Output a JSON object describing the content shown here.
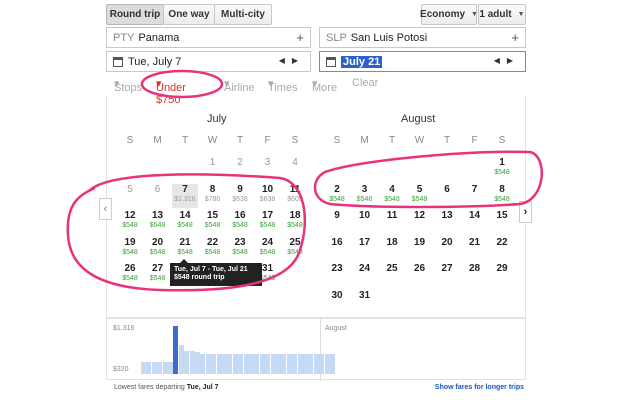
{
  "trip_tabs": [
    {
      "label": "Round trip",
      "selected": true
    },
    {
      "label": "One way"
    },
    {
      "label": "Multi-city"
    }
  ],
  "cabin": "Economy",
  "passengers": "1 adult",
  "origin": {
    "code": "PTY",
    "city": "Panama"
  },
  "destination": {
    "code": "SLP",
    "city": "San Luis Potosi"
  },
  "depart_date": "Tue, July 7",
  "return_date": "July 21",
  "filters": {
    "stops": "Stops",
    "price": "Under $750",
    "airline": "Airline",
    "times": "Times",
    "more": "More",
    "clear": "Clear"
  },
  "weekdays": [
    "S",
    "M",
    "T",
    "W",
    "T",
    "F",
    "S"
  ],
  "july": {
    "name": "July",
    "days": [
      {
        "d": "1",
        "p": ""
      },
      {
        "d": "2",
        "p": ""
      },
      {
        "d": "3",
        "p": ""
      },
      {
        "d": "4",
        "p": ""
      },
      {
        "d": "5",
        "p": ""
      },
      {
        "d": "6",
        "p": ""
      },
      {
        "d": "7",
        "p": "$1,316"
      },
      {
        "d": "8",
        "p": "$780"
      },
      {
        "d": "9",
        "p": "$638"
      },
      {
        "d": "10",
        "p": "$638"
      },
      {
        "d": "11",
        "p": "$609"
      },
      {
        "d": "12",
        "p": "$548"
      },
      {
        "d": "13",
        "p": "$548"
      },
      {
        "d": "14",
        "p": "$548"
      },
      {
        "d": "15",
        "p": "$548"
      },
      {
        "d": "16",
        "p": "$548"
      },
      {
        "d": "17",
        "p": "$548"
      },
      {
        "d": "18",
        "p": "$548"
      },
      {
        "d": "19",
        "p": "$548"
      },
      {
        "d": "20",
        "p": "$548"
      },
      {
        "d": "21",
        "p": "$548"
      },
      {
        "d": "22",
        "p": "$548"
      },
      {
        "d": "23",
        "p": "$548"
      },
      {
        "d": "24",
        "p": "$548"
      },
      {
        "d": "25",
        "p": "$548"
      },
      {
        "d": "26",
        "p": "$548"
      },
      {
        "d": "27",
        "p": "$548"
      },
      {
        "d": "28",
        "p": ""
      },
      {
        "d": "29",
        "p": ""
      },
      {
        "d": "30",
        "p": ""
      },
      {
        "d": "31",
        "p": "$548"
      }
    ]
  },
  "august": {
    "name": "August",
    "days": [
      {
        "d": "1",
        "p": "$548"
      },
      {
        "d": "2",
        "p": "$548"
      },
      {
        "d": "3",
        "p": "$548"
      },
      {
        "d": "4",
        "p": "$548"
      },
      {
        "d": "5",
        "p": "$548"
      },
      {
        "d": "6",
        "p": ""
      },
      {
        "d": "7",
        "p": ""
      },
      {
        "d": "8",
        "p": "$548"
      },
      {
        "d": "9",
        "p": ""
      },
      {
        "d": "10",
        "p": ""
      },
      {
        "d": "11",
        "p": ""
      },
      {
        "d": "12",
        "p": ""
      },
      {
        "d": "13",
        "p": ""
      },
      {
        "d": "14",
        "p": ""
      },
      {
        "d": "15",
        "p": ""
      },
      {
        "d": "16",
        "p": ""
      },
      {
        "d": "17",
        "p": ""
      },
      {
        "d": "18",
        "p": ""
      },
      {
        "d": "19",
        "p": ""
      },
      {
        "d": "20",
        "p": ""
      },
      {
        "d": "21",
        "p": ""
      },
      {
        "d": "22",
        "p": ""
      },
      {
        "d": "23",
        "p": ""
      },
      {
        "d": "24",
        "p": ""
      },
      {
        "d": "25",
        "p": ""
      },
      {
        "d": "26",
        "p": ""
      },
      {
        "d": "27",
        "p": ""
      },
      {
        "d": "28",
        "p": ""
      },
      {
        "d": "29",
        "p": ""
      },
      {
        "d": "30",
        "p": ""
      },
      {
        "d": "31",
        "p": ""
      }
    ]
  },
  "tooltip": {
    "line1": "Tue, Jul 7 - Tue, Jul 21",
    "line2": "$548 round trip"
  },
  "chart": {
    "max_label": "$1,316",
    "min_label": "$320",
    "month_label": "August"
  },
  "chart_data": {
    "type": "bar",
    "values": [
      320,
      320,
      320,
      320,
      320,
      320,
      1316,
      780,
      638,
      638,
      609,
      548,
      548,
      548,
      548,
      548,
      548,
      548,
      548,
      548,
      548,
      548,
      548,
      548,
      548,
      548,
      548,
      548,
      548,
      548,
      548,
      548,
      548,
      548,
      548,
      548
    ],
    "ylim": [
      320,
      1316
    ],
    "selected_index": 6
  },
  "footer": {
    "prefix": "Lowest fares departing",
    "date": "Tue, Jul 7",
    "link": "Show fares for longer trips"
  },
  "colors": {
    "price_green": "#3a9e3a",
    "accent_blue": "#3b6cc9",
    "annotation_pink": "#e8327c"
  }
}
